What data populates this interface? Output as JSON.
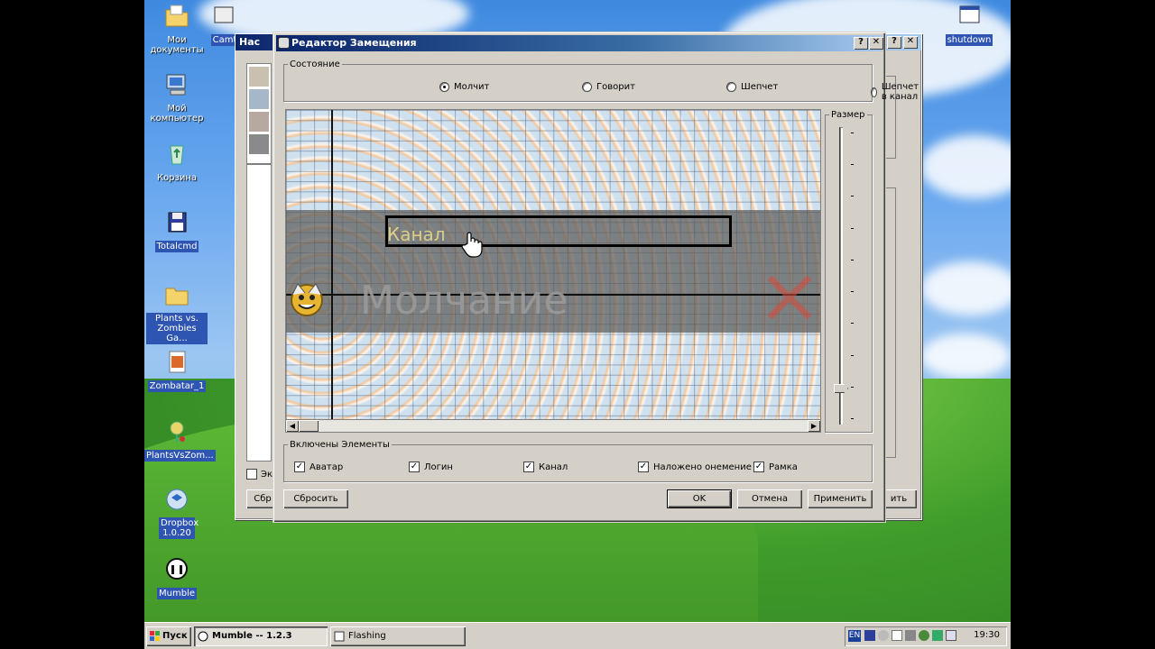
{
  "desktop": {
    "icons": [
      {
        "label": "Мои документы"
      },
      {
        "label": "Мой компьютер"
      },
      {
        "label": "Корзина"
      },
      {
        "label": "Totalcmd"
      },
      {
        "label": "Plants vs. Zombies Ga..."
      },
      {
        "label": "Zombatar_1"
      },
      {
        "label": "PlantsVsZom..."
      },
      {
        "label": "Dropbox 1.0.20"
      },
      {
        "label": "Mumble"
      },
      {
        "label": "shutdown"
      },
      {
        "label": "Camt"
      }
    ]
  },
  "back_window": {
    "title": "Нас",
    "left_labels": [
      "Эк",
      "Сбр"
    ],
    "right_button": "ить"
  },
  "dialog": {
    "title": "Редактор Замещения",
    "help_button": "?",
    "close_button": "✕",
    "state_group": {
      "label": "Состояние",
      "options": [
        {
          "label": "Молчит",
          "selected": true
        },
        {
          "label": "Говорит",
          "selected": false
        },
        {
          "label": "Шепчет",
          "selected": false
        },
        {
          "label": "Шепчет в канал",
          "selected": false
        }
      ]
    },
    "preview": {
      "channel_text": "Канал",
      "user_text": "Молчание"
    },
    "size_group": {
      "label": "Размер"
    },
    "elements_group": {
      "label": "Включены Элементы",
      "items": [
        {
          "label": "Аватар",
          "checked": true
        },
        {
          "label": "Логин",
          "checked": true
        },
        {
          "label": "Канал",
          "checked": true
        },
        {
          "label": "Наложено онемение",
          "checked": true
        },
        {
          "label": "Рамка",
          "checked": true
        }
      ]
    },
    "buttons": {
      "reset": "Сбросить",
      "ok": "OK",
      "cancel": "Отмена",
      "apply": "Применить"
    }
  },
  "taskbar": {
    "start": "Пуск",
    "tasks": [
      {
        "label": "Mumble -- 1.2.3",
        "active": true
      },
      {
        "label": "Flashing",
        "active": false
      }
    ],
    "lang": "EN",
    "clock": "19:30"
  }
}
